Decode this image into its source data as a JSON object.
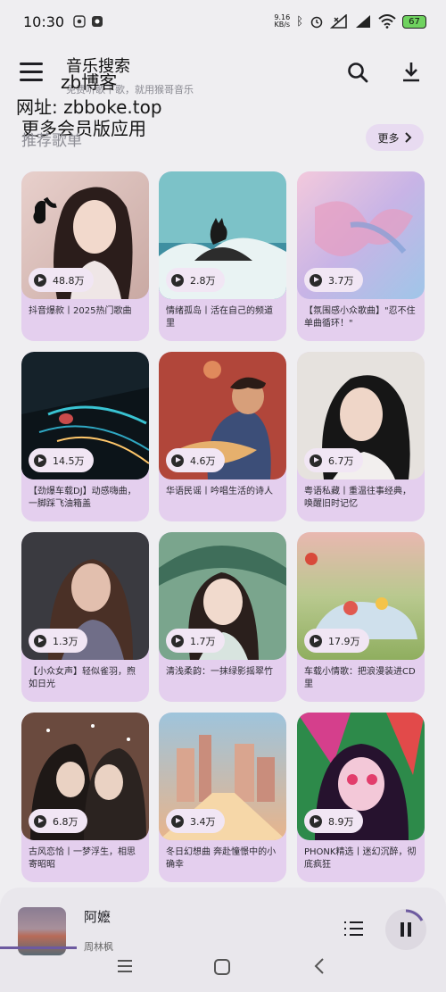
{
  "status_bar": {
    "time": "10:30",
    "net_speed_value": "9.16",
    "net_speed_unit": "KB/s",
    "battery": "67"
  },
  "app_bar": {
    "title": "音乐搜索",
    "subtitle": "免费听歌下歌，就用猴哥音乐"
  },
  "watermark": {
    "line1": "zb博客",
    "line2": "网址: zbboke.top",
    "line3": "更多会员版应用"
  },
  "section": {
    "title": "推荐歌单",
    "more_label": "更多"
  },
  "playlists": [
    {
      "plays": "48.8万",
      "title": "抖音爆款丨2025热门歌曲"
    },
    {
      "plays": "2.8万",
      "title": "情绪孤岛丨活在自己的频道里"
    },
    {
      "plays": "3.7万",
      "title": "【氛围感小众歌曲】\"忍不住单曲循环！\""
    },
    {
      "plays": "14.5万",
      "title": "【劲爆车载DJ】动感嗨曲，一脚踩飞油箱盖"
    },
    {
      "plays": "4.6万",
      "title": "华语民谣丨吟唱生活的诗人"
    },
    {
      "plays": "6.7万",
      "title": "粤语私藏丨重温往事经典，唤醒旧时记忆"
    },
    {
      "plays": "1.3万",
      "title": "【小众女声】轻似雀羽，煦如日光"
    },
    {
      "plays": "1.7万",
      "title": "清浅柔韵：一抹绿影摇翠竹"
    },
    {
      "plays": "17.9万",
      "title": "车载小情歌：把浪漫装进CD里"
    },
    {
      "plays": "6.8万",
      "title": "古风恋恰丨一梦浮生，相思寄昭昭"
    },
    {
      "plays": "3.4万",
      "title": "冬日幻想曲 奔赴憧憬中的小确幸"
    },
    {
      "plays": "8.9万",
      "title": "PHONK精选丨迷幻沉醉，彻底疯狂"
    }
  ],
  "player": {
    "song": "阿嬷",
    "artist": "周林枫"
  },
  "colors": {
    "card_bg": "#e4cfee",
    "more_bg": "#e8dbf1",
    "accent": "#6d5aa0"
  }
}
